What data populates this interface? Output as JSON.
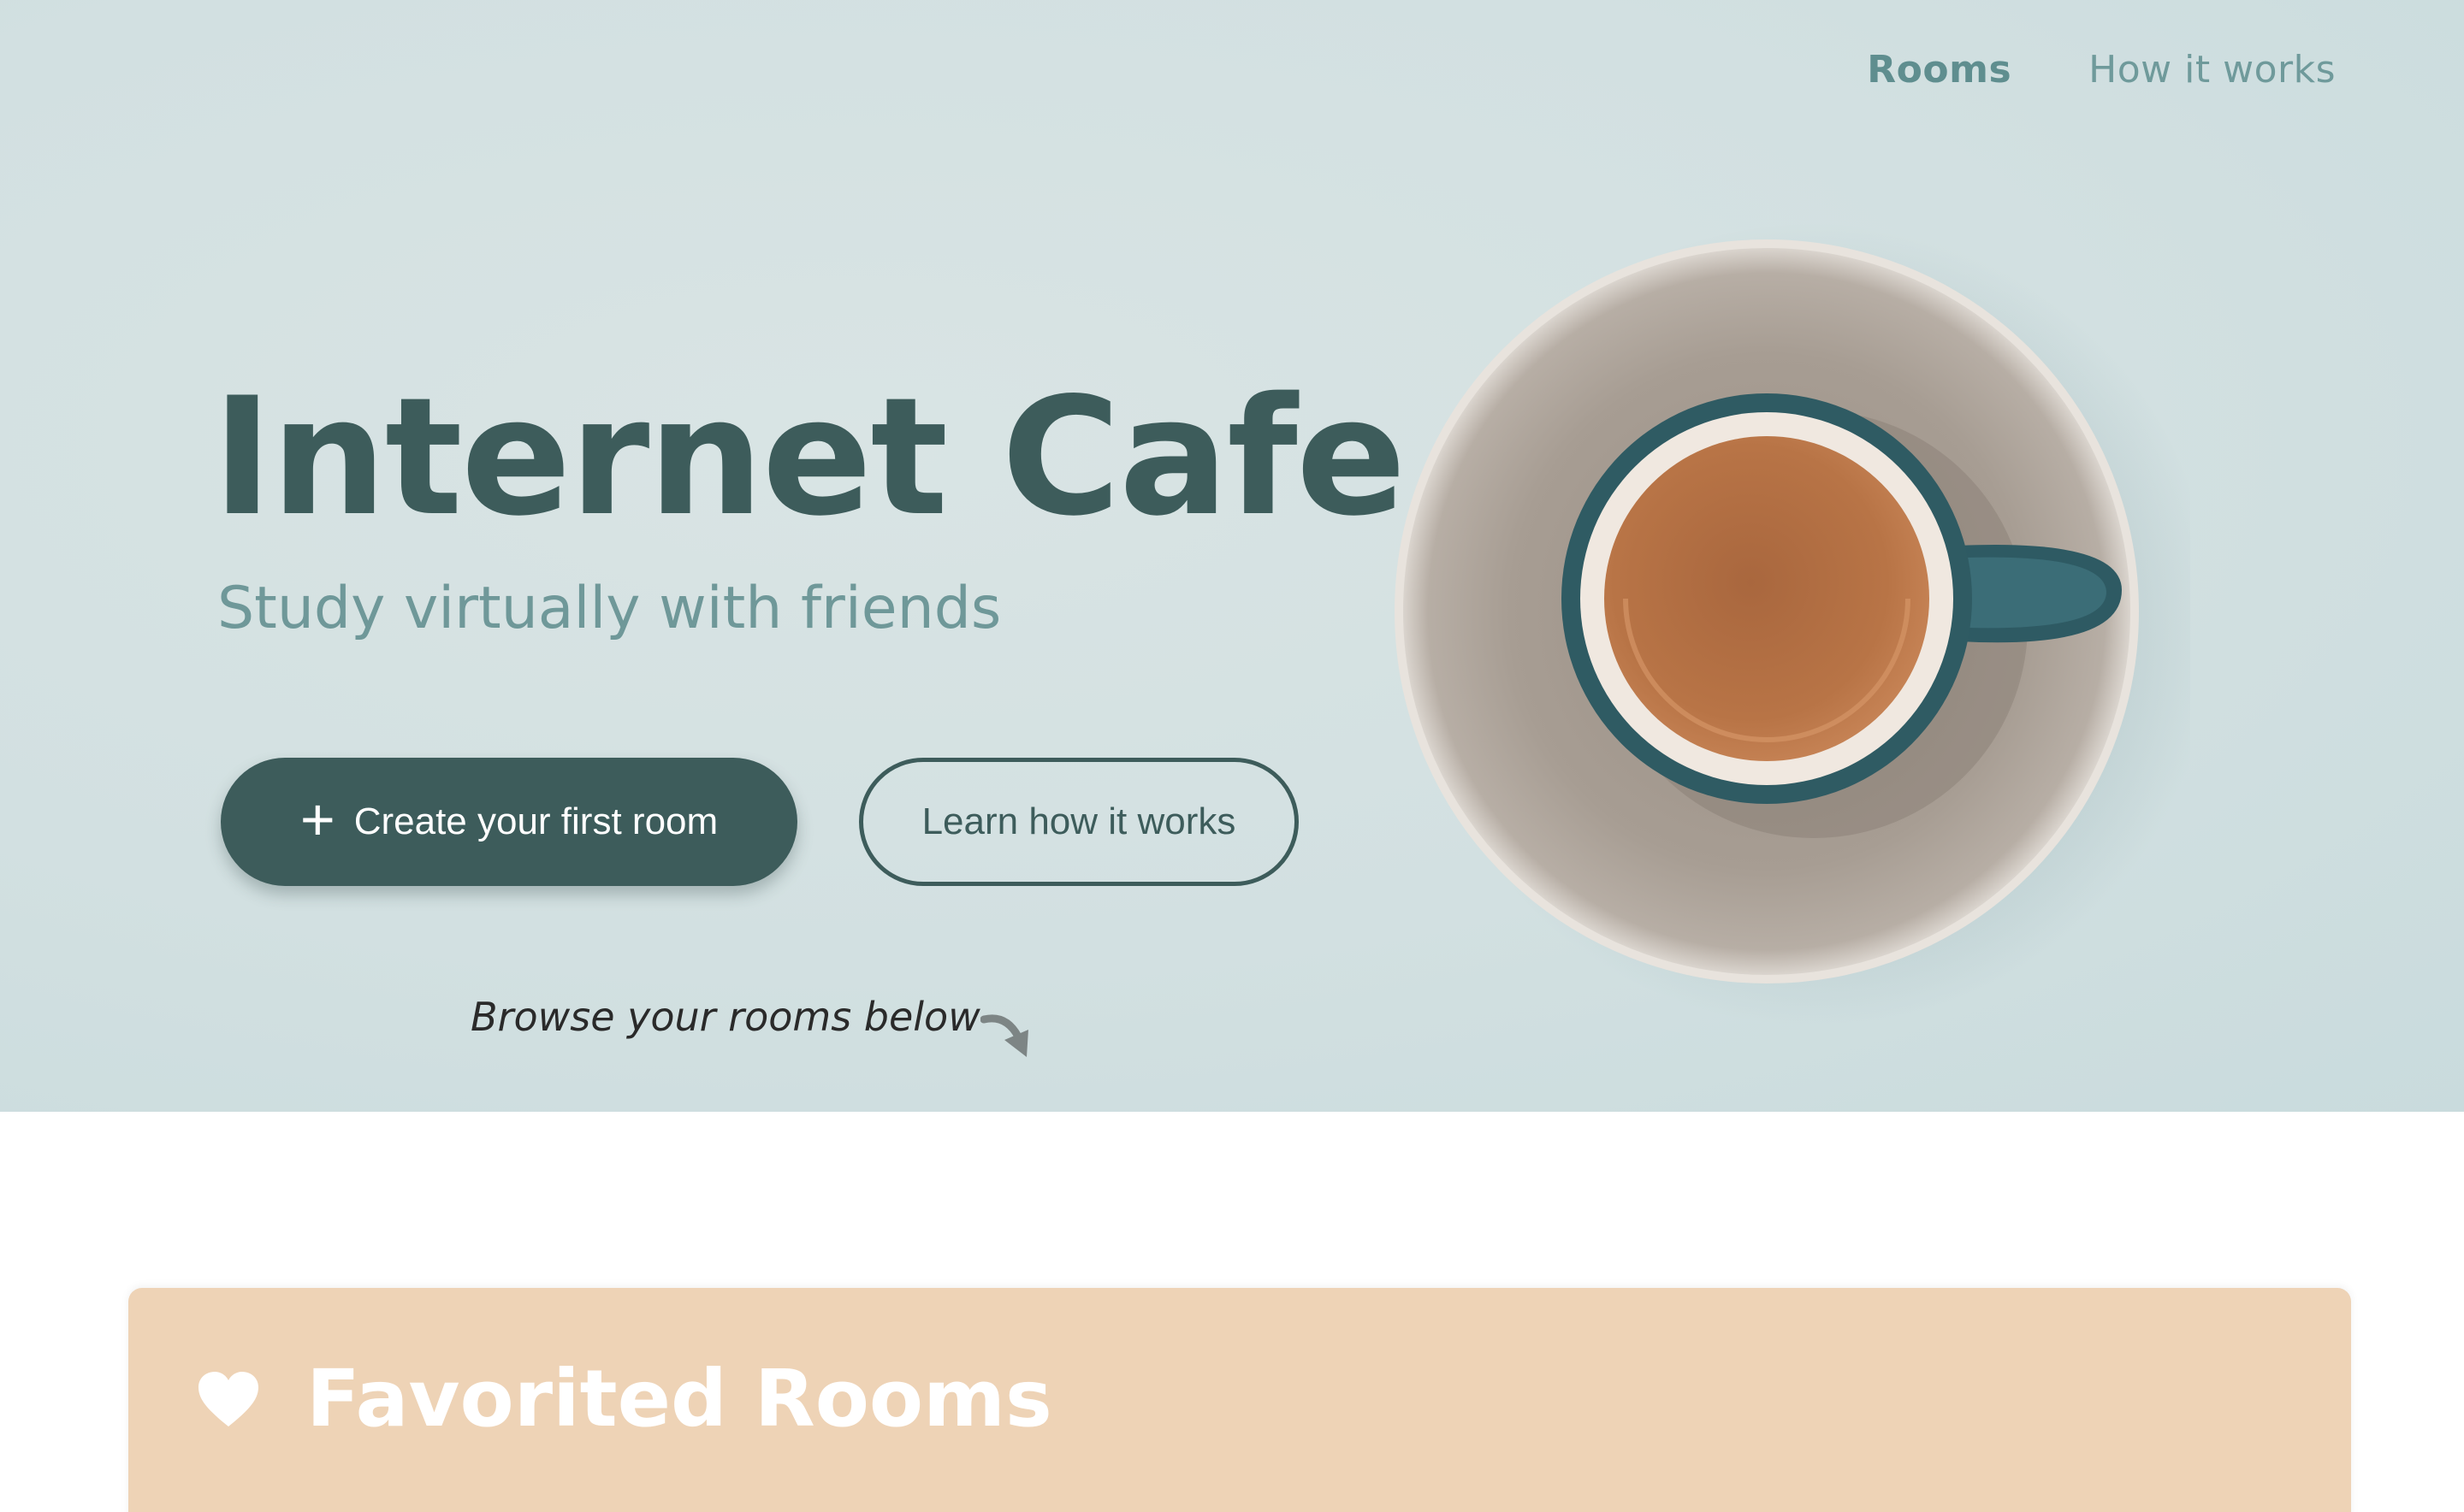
{
  "nav": {
    "items": [
      {
        "label": "Rooms",
        "active": true
      },
      {
        "label": "How it works",
        "active": false
      }
    ]
  },
  "hero": {
    "title": "Internet Cafe",
    "subtitle": "Study virtually with friends",
    "primary_button": {
      "icon": "plus-icon",
      "label": "Create your first room"
    },
    "secondary_button": {
      "label": "Learn how it works"
    },
    "browse_hint": "Browse your rooms below",
    "hint_icon": "curved-arrow-down-icon"
  },
  "favorites": {
    "icon": "heart-icon",
    "title": "Favorited Rooms"
  },
  "colors": {
    "hero_background": "#d2e0e1",
    "primary": "#3d5c5b",
    "nav_text": "#6f9a9b",
    "favorites_background": "#eed3b6"
  }
}
